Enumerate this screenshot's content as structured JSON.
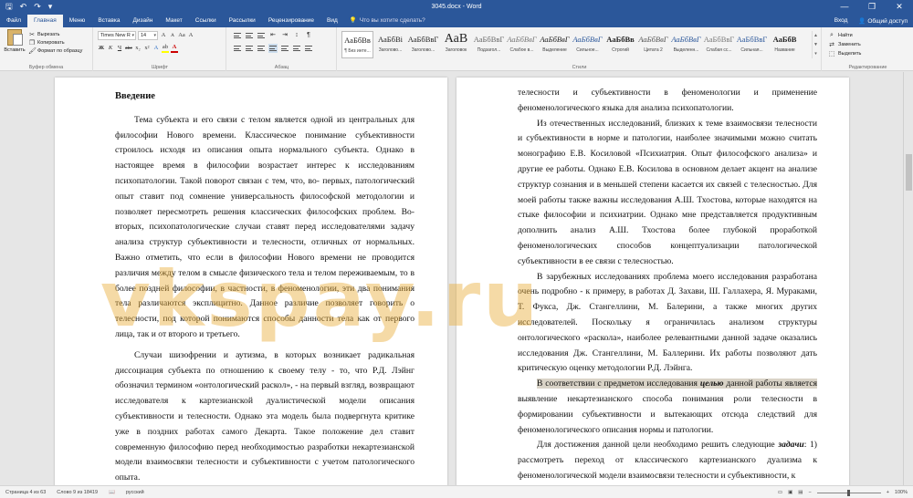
{
  "window": {
    "title": "3045.docx - Word",
    "controls": [
      "—",
      "❐",
      "✕"
    ]
  },
  "qat": {
    "save": "🖫",
    "undo": "↶",
    "redo": "↷",
    "customize": "▾"
  },
  "tabs": [
    {
      "label": "Файл",
      "active": false
    },
    {
      "label": "Главная",
      "active": true
    },
    {
      "label": "Меню",
      "active": false
    },
    {
      "label": "Вставка",
      "active": false
    },
    {
      "label": "Дизайн",
      "active": false
    },
    {
      "label": "Макет",
      "active": false
    },
    {
      "label": "Ссылки",
      "active": false
    },
    {
      "label": "Рассылки",
      "active": false
    },
    {
      "label": "Рецензирование",
      "active": false
    },
    {
      "label": "Вид",
      "active": false
    }
  ],
  "tell_me": {
    "placeholder": "Что вы хотите сделать?",
    "icon": "lightbulb-icon"
  },
  "account": {
    "signin": "Вход",
    "share": "Общий доступ"
  },
  "ribbon": {
    "clipboard": {
      "paste": "Вставить",
      "cut": "Вырезать",
      "copy": "Копировать",
      "format_painter": "Формат по образцу",
      "label": "Буфер обмена"
    },
    "font": {
      "family": "Times New R",
      "size": "14",
      "label": "Шрифт",
      "grow": "A",
      "shrink": "A",
      "case": "Aa",
      "clear": "A",
      "bold": "Ж",
      "italic": "К",
      "underline": "Ч",
      "strike": "abc",
      "sub": "x₂",
      "sup": "x²",
      "effects": "A",
      "highlight": "ab",
      "color": "A"
    },
    "paragraph": {
      "label": "Абзац",
      "pilcrow": "¶",
      "sort": "↕",
      "indent": "⇥",
      "outdent": "⇤"
    },
    "styles": {
      "label": "Стили",
      "items": [
        {
          "preview": "АаБбВв",
          "name": "¶ Без инте..."
        },
        {
          "preview": "АаБбВі",
          "name": "Заголово..."
        },
        {
          "preview": "АаБбВвГ",
          "name": "Заголово..."
        },
        {
          "preview": "АаВ",
          "name": "Заголовок"
        },
        {
          "preview": "АаБбВвГ",
          "name": "Подзагол..."
        },
        {
          "preview": "АаБбВвГ",
          "name": "Слабое в..."
        },
        {
          "preview": "АаБбВвГ",
          "name": "Выделение"
        },
        {
          "preview": "АаБбВвГ",
          "name": "Сильное..."
        },
        {
          "preview": "АаБбВв",
          "name": "Строгий"
        },
        {
          "preview": "АаБбВвГ",
          "name": "Цитата 2"
        },
        {
          "preview": "АаБбВвГ",
          "name": "Выделенн..."
        },
        {
          "preview": "АаБбВвГ",
          "name": "Слабая сс..."
        },
        {
          "preview": "АаБбВвГ",
          "name": "Сильная..."
        },
        {
          "preview": "АаБбВ",
          "name": "Название"
        }
      ]
    },
    "editing": {
      "label": "Редактирование",
      "find": "Найти",
      "replace": "Заменить",
      "select": "Выделить"
    }
  },
  "document": {
    "left_page": {
      "heading": "Введение",
      "paragraphs": [
        "Тема субъекта и его связи с телом является одной из центральных для философии Нового времени. Классическое понимание субъективности строилось исходя из описания опыта нормального субъекта. Однако в настоящее время в философии возрастает интерес к исследованиям психопатологии. Такой поворот связан с тем, что, во- первых, патологический опыт ставит под сомнение универсальность философской методологии и позволяет пересмотреть решения классических философских проблем. Во-вторых, психопатологические случаи ставят перед исследователями задачу анализа структур субъективности и телесности, отличных от нормальных. Важно отметить, что если в философии Нового времени не проводится различия между телом в смысле физического тела и телом переживаемым, то в более поздней философии, в частности, в феноменологии, эти два понимания тела различаются эксплицитно. Данное различие позволяет говорить о телесности, под которой понимаются способы данности тела как от первого лица, так и от второго и третьего.",
        "Случаи шизофрении и аутизма, в которых возникает радикальная диссоциация субъекта по отношению к своему телу - то, что Р.Д. Лэйнг обозначил термином «онтологический раскол», - на первый взгляд, возвращают исследователя к картезианской дуалистической модели описания субъективности и телесности. Однако эта модель была подвергнута критике уже в поздних работах самого Декарта. Такое положение дел ставит современную философию перед необходимостью разработки некартезианской модели взаимосвязи телесности и субъективности с учетом патологического опыта."
      ]
    },
    "right_page": {
      "cont": "телесности и субъективности в феноменологии и применение феноменологического языка для анализа психопатологии.",
      "p1": "Из отечественных исследований, близких к теме взаимосвязи телесности и субъективности в норме и патологии, наиболее значимыми можно считать монографию Е.В. Косиловой «Психиатрия. Опыт философского анализа» и другие ее работы. Однако Е.В. Косилова в основном делает акцент на анализе структур сознания и в меньшей степени касается их связей с телесностью. Для моей работы также важны исследования А.Ш. Тхостова, которые находятся на стыке философии и психиатрии. Однако мне представляется продуктивным дополнить анализ А.Ш. Тхостова более глубокой проработкой феноменологических способов концептуализации патологической субъективности в ее связи с телесностью.",
      "p2": "В зарубежных исследованиях проблема моего исследования разработана очень подробно - к примеру, в работах Д. Захави, Ш. Галлахера, Я. Мураками, Т. Фукса, Дж. Стангеллини, М. Балерини, а также многих других исследователей. Поскольку я ограничилась анализом структуры онтологического «раскола», наиболее релевантными данной задаче оказались исследования Дж. Стангеллини, М. Баллерини. Их работы позволяют дать критическую оценку методологии Р.Д. Лэйнга.",
      "p3_shaded": "В соответствии с предметом исследования",
      "p3_mark": "целью",
      "p3_shaded_end": "данной работы является",
      "p3_rest": "выявление некартезианского способа понимания роли телесности в формировании субъективности и вытекающих отсюда следствий для феноменологического описания нормы и патологии.",
      "p4_start": "Для достижения данной цели необходимо решить следующие",
      "p4_mark": "задачи",
      "p4_rest": ": 1) рассмотреть переход от классического картезианского дуализма к феноменологической модели взаимосвязи телесности и субъективности, к"
    },
    "watermark": "vkspay.ru"
  },
  "status": {
    "page": "Страница 4 из 63",
    "words": "Слово 9 из 18419",
    "proof_icon": "proofing-icon",
    "language": "русский",
    "zoom": "100%"
  }
}
